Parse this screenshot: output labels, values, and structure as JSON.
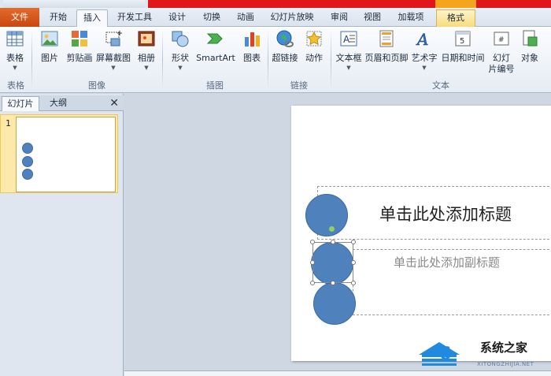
{
  "tabs": {
    "file": "文件",
    "home": "开始",
    "insert": "插入",
    "developer": "开发工具",
    "design": "设计",
    "transitions": "切换",
    "animations": "动画",
    "slideshow": "幻灯片放映",
    "review": "审阅",
    "view": "视图",
    "addins": "加载项",
    "format": "格式"
  },
  "ribbon": {
    "table": "表格",
    "picture": "图片",
    "clipart": "剪贴画",
    "screenshot": "屏幕截图",
    "album": "相册",
    "shapes": "形状",
    "smartart": "SmartArt",
    "chart": "图表",
    "hyperlink": "超链接",
    "action": "动作",
    "textbox": "文本框",
    "headerfooter": "页眉和页脚",
    "wordart": "艺术字",
    "datetime": "日期和时间",
    "slidenumber_1": "幻灯",
    "slidenumber_2": "片编号",
    "object": "对象",
    "groups": {
      "tables": "表格",
      "images": "图像",
      "illustrations": "插图",
      "links": "链接",
      "text": "文本"
    }
  },
  "panel": {
    "slides_tab": "幻灯片",
    "outline_tab": "大纲",
    "close": "✕",
    "slide_number": "1"
  },
  "slide": {
    "title_placeholder": "单击此处添加标题",
    "subtitle_placeholder": "单击此处添加副标题"
  },
  "watermark": {
    "brand": "系统之家",
    "url": "XITONGZHIJIA.NET"
  },
  "colors": {
    "circle_fill": "#4f81bd",
    "file_tab": "#d4571b",
    "title_red": "#e0161b",
    "tools_tab": "#f4a51c"
  }
}
